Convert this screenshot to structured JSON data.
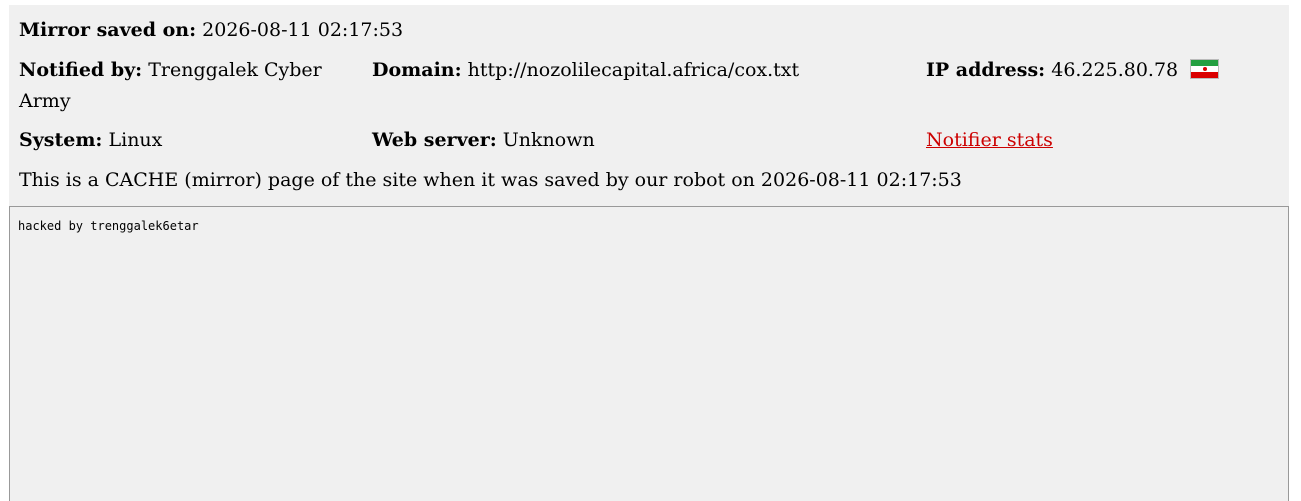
{
  "saved": {
    "label": "Mirror saved on:",
    "value": "2026-08-11 02:17:53"
  },
  "notified": {
    "label": "Notified by:",
    "value": "Trenggalek Cyber Army"
  },
  "domain": {
    "label": "Domain:",
    "value": "http://nozolilecapital.africa/cox.txt"
  },
  "ip": {
    "label": "IP address:",
    "value": "46.225.80.78",
    "flag_icon": "iran-flag-icon"
  },
  "system": {
    "label": "System:",
    "value": "Linux"
  },
  "webserver": {
    "label": "Web server:",
    "value": "Unknown"
  },
  "notifier_stats": {
    "label": "Notifier stats",
    "color": "#cc0000"
  },
  "cache_notice": "This is a CACHE (mirror) page of the site when it was saved by our robot on 2026-08-11 02:17:53",
  "mirror": {
    "content": "hacked by trenggalek6etar"
  }
}
